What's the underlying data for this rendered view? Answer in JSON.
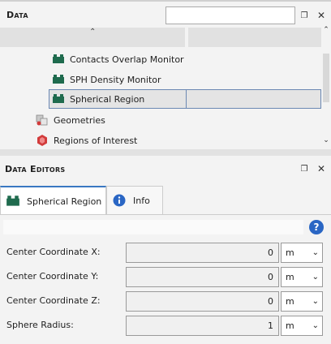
{
  "data_panel": {
    "title": "Data",
    "search_placeholder": "",
    "tree_items": [
      {
        "label": "Contacts Overlap Monitor",
        "icon": "monitor-icon"
      },
      {
        "label": "SPH Density Monitor",
        "icon": "monitor-icon"
      },
      {
        "label": "Spherical Region",
        "icon": "region-icon",
        "selected": true
      },
      {
        "label": "Geometries",
        "icon": "geometries-icon"
      },
      {
        "label": "Regions of Interest",
        "icon": "regions-of-interest-icon"
      }
    ]
  },
  "editors_panel": {
    "title": "Data Editors",
    "tabs": [
      {
        "label": "Spherical Region",
        "icon": "region-icon",
        "active": true
      },
      {
        "label": "Info",
        "icon": "info-icon",
        "active": false
      }
    ],
    "properties": [
      {
        "label": "Center Coordinate X:",
        "value": "0",
        "unit": "m"
      },
      {
        "label": "Center Coordinate Y:",
        "value": "0",
        "unit": "m"
      },
      {
        "label": "Center Coordinate Z:",
        "value": "0",
        "unit": "m"
      },
      {
        "label": "Sphere Radius:",
        "value": "1",
        "unit": "m"
      }
    ]
  },
  "colors": {
    "monitor_icon": "#1f6b4e",
    "selection_border": "#6b88b3",
    "help_icon": "#2a66c4",
    "roi_icon": "#d23b3b"
  }
}
